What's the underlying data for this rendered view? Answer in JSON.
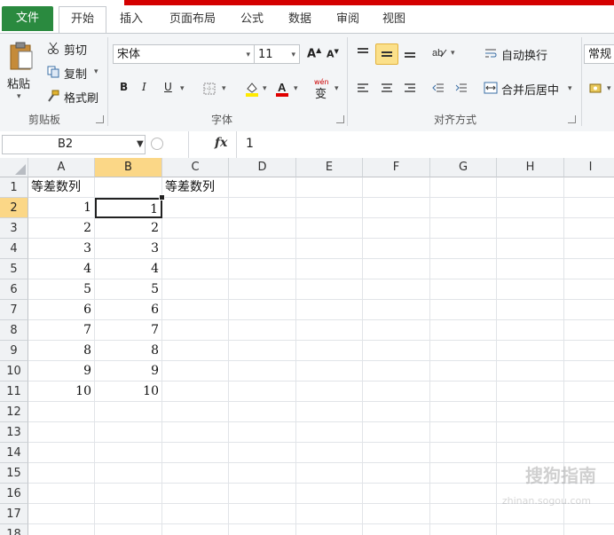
{
  "ribbon_tabs": {
    "file": "文件",
    "home": "开始",
    "insert": "插入",
    "page_layout": "页面布局",
    "formulas": "公式",
    "data": "数据",
    "review": "审阅",
    "view": "视图"
  },
  "clipboard": {
    "paste": "粘贴",
    "cut": "剪切",
    "copy": "复制",
    "format_painter": "格式刷",
    "group_label": "剪贴板"
  },
  "font": {
    "name": "宋体",
    "size": "11",
    "bold": "B",
    "italic": "I",
    "underline": "U",
    "group_label": "字体",
    "wen": "wén",
    "wen_char": "变"
  },
  "alignment": {
    "wrap_text": "自动换行",
    "merge_center": "合并后居中",
    "group_label": "对齐方式"
  },
  "number": {
    "format": "常规"
  },
  "formula_bar": {
    "name_box": "B2",
    "fx": "fx",
    "content": "1"
  },
  "columns": [
    "A",
    "B",
    "C",
    "D",
    "E",
    "F",
    "G",
    "H",
    "I"
  ],
  "rows": [
    "1",
    "2",
    "3",
    "4",
    "5",
    "6",
    "7",
    "8",
    "9",
    "10",
    "11",
    "12",
    "13",
    "14",
    "15",
    "16",
    "17",
    "18"
  ],
  "cells": {
    "A1": "等差数列",
    "C1": "等差数列",
    "A": [
      "1",
      "2",
      "3",
      "4",
      "5",
      "6",
      "7",
      "8",
      "9",
      "10"
    ],
    "B": [
      "1",
      "2",
      "3",
      "4",
      "5",
      "6",
      "7",
      "8",
      "9",
      "10"
    ]
  },
  "active_cell": "B2",
  "watermark": {
    "text": "搜狗指南",
    "url": "zhinan.sogou.com"
  },
  "colors": {
    "file_tab": "#2a8a3f",
    "selection_header": "#fbd787",
    "top_bar": "#d40000"
  }
}
